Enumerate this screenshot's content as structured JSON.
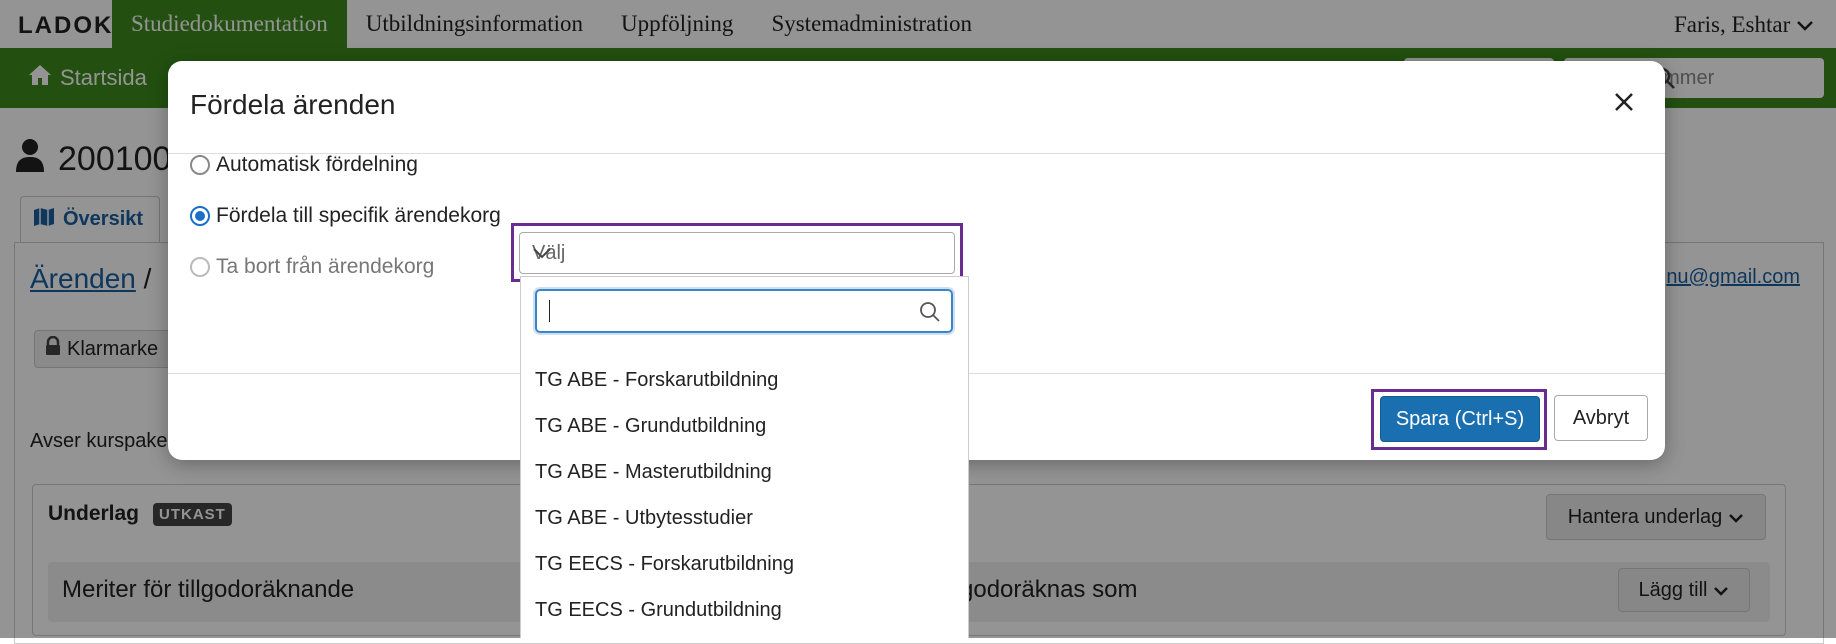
{
  "app": {
    "logo": "LADOK",
    "nav": [
      "Studiedokumentation",
      "Utbildningsinformation",
      "Uppföljning",
      "Systemadministration"
    ],
    "user": "Faris, Eshtar"
  },
  "subbar": {
    "home_label": "Startsida",
    "search_placeholder": "ummer"
  },
  "page": {
    "student_id": "200100",
    "tab_overview": "Översikt",
    "breadcrumb_link": "Ärenden",
    "breadcrumb_sep": "/",
    "email": "nu@gmail.com",
    "klarmarke": "Klarmarke",
    "avser": "Avser kurspake",
    "underlag_title": "Underlag",
    "utkast_badge": "UTKAST",
    "hantera_underlag": "Hantera underlag",
    "meriter": "Meriter för tillgodoräknande",
    "tillgodo": "godoräknas som",
    "lagg_till": "Lägg till"
  },
  "modal": {
    "title": "Fördela ärenden",
    "options": [
      {
        "label": "Automatisk fördelning",
        "checked": false,
        "disabled": false
      },
      {
        "label": "Fördela till specifik ärendekorg",
        "checked": true,
        "disabled": false
      },
      {
        "label": "Ta bort från ärendekorg",
        "checked": false,
        "disabled": true
      }
    ],
    "select_placeholder": "Välj",
    "save_label": "Spara (Ctrl+S)",
    "cancel_label": "Avbryt"
  },
  "dropdown": {
    "search_value": "",
    "items": [
      "TG ABE - Forskarutbildning",
      "TG ABE - Grundutbildning",
      "TG ABE - Masterutbildning",
      "TG ABE - Utbytesstudier",
      "TG EECS - Forskarutbildning",
      "TG EECS - Grundutbildning"
    ]
  },
  "colors": {
    "green": "#3d8b1c",
    "primary": "#1a6fb0",
    "highlight_frame": "#6b2c91",
    "link": "#1a5f9e"
  }
}
